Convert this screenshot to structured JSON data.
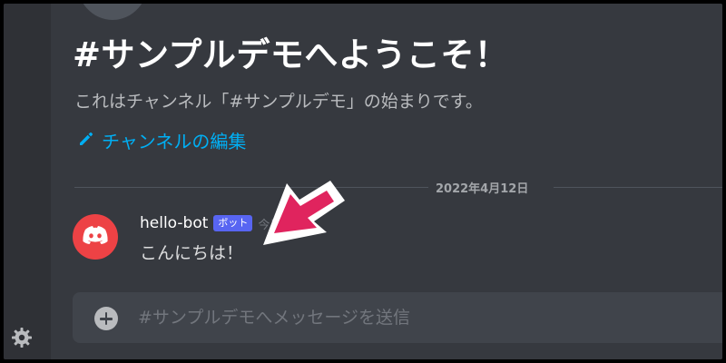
{
  "welcome": {
    "title": "#サンプルデモへようこそ！",
    "subtitle": "これはチャンネル「#サンプルデモ」の始まりです。",
    "edit_link": "チャンネルの編集"
  },
  "date_divider": "2022年4月12日",
  "message": {
    "author": "hello-bot",
    "bot_tag": "ボット",
    "timestamp": "今日 09",
    "text": "こんにちは！"
  },
  "composer": {
    "placeholder": "#サンプルデモへメッセージを送信"
  },
  "icons": {
    "settings": "gear-icon",
    "edit": "pencil-icon",
    "avatar": "discord-logo-icon",
    "attach": "plus-circle-icon",
    "annotation": "arrow-annotation"
  },
  "colors": {
    "background": "#36393f",
    "sidebar": "#2f3136",
    "link": "#00aff4",
    "bot_tag": "#5865f2",
    "avatar": "#ed4245",
    "annotation_arrow": "#e0245e"
  }
}
